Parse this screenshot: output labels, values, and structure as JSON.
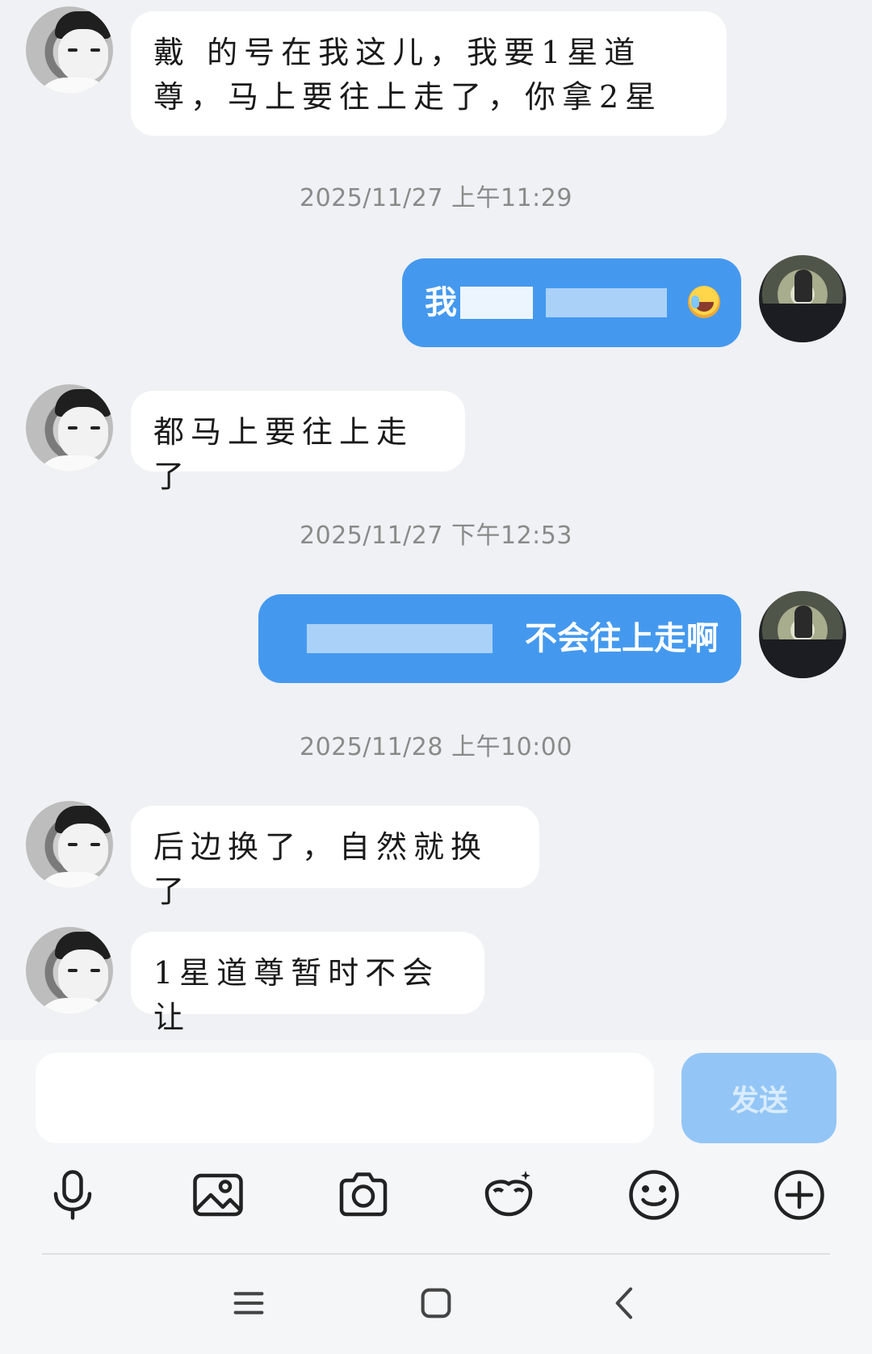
{
  "messages": [
    {
      "side": "in",
      "text": "戴 的号在我这儿，我要1星道尊，马上要往上走了，你拿2星"
    },
    {
      "side": "ts",
      "text": "2025/11/27 上午11:29"
    },
    {
      "side": "out",
      "text": "我"
    },
    {
      "side": "in",
      "text": "都马上要往上走了"
    },
    {
      "side": "ts",
      "text": "2025/11/27 下午12:53"
    },
    {
      "side": "out",
      "text": "不会往上走啊"
    },
    {
      "side": "ts",
      "text": "2025/11/28 上午10:00"
    },
    {
      "side": "in",
      "text": "后边换了，自然就换了"
    },
    {
      "side": "in",
      "text": "1星道尊暂时不会让"
    }
  ],
  "composer": {
    "send_label": "发送",
    "input_value": ""
  },
  "toolbar": {
    "icons": [
      "microphone-icon",
      "image-icon",
      "camera-icon",
      "emoji-mask-icon",
      "smiley-icon",
      "plus-circle-icon"
    ]
  },
  "navbar": {
    "icons": [
      "menu-icon",
      "home-icon",
      "back-icon"
    ]
  },
  "colors": {
    "outgoing_bubble": "#4499ef",
    "incoming_bubble": "#ffffff",
    "send_button": "#93c6f6",
    "background": "#f0f1f4"
  }
}
